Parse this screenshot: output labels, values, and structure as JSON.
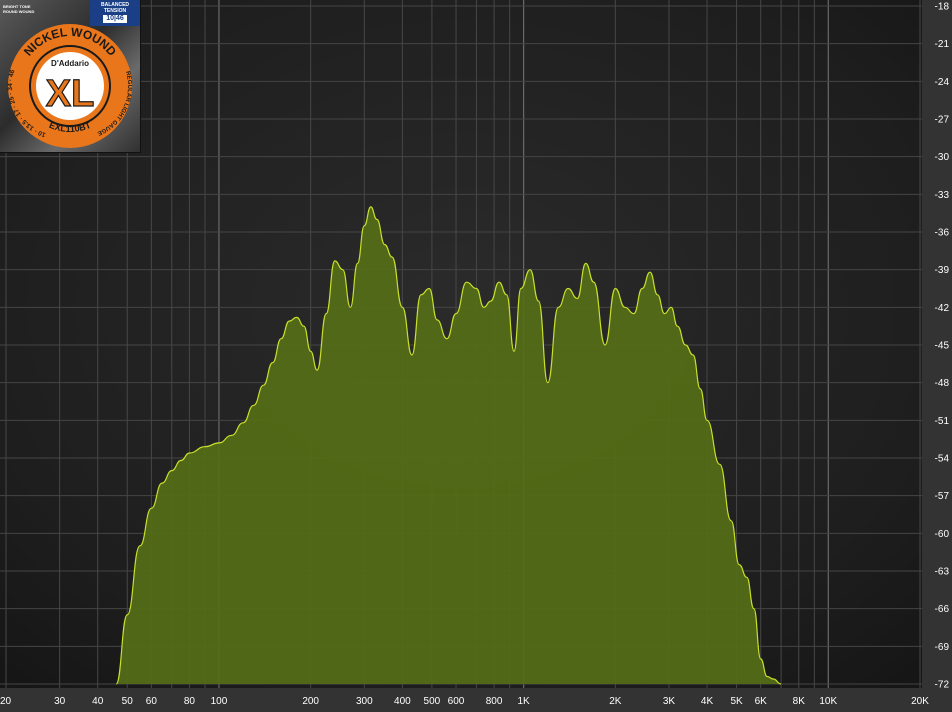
{
  "chart_data": {
    "type": "area",
    "title": "",
    "xlabel": "",
    "ylabel": "",
    "x_scale": "log",
    "xlim": [
      20,
      20000
    ],
    "ylim": [
      -72,
      -18
    ],
    "grid": true,
    "fill_color": "#546e16",
    "line_color": "#c8e02a",
    "background_color": "#1c1c1c",
    "x_tick_labels": [
      {
        "value": 20,
        "label": "20"
      },
      {
        "value": 30,
        "label": "30"
      },
      {
        "value": 40,
        "label": "40"
      },
      {
        "value": 50,
        "label": "50"
      },
      {
        "value": 60,
        "label": "60"
      },
      {
        "value": 80,
        "label": "80"
      },
      {
        "value": 100,
        "label": "100"
      },
      {
        "value": 200,
        "label": "200"
      },
      {
        "value": 300,
        "label": "300"
      },
      {
        "value": 400,
        "label": "400"
      },
      {
        "value": 500,
        "label": "500"
      },
      {
        "value": 600,
        "label": "600"
      },
      {
        "value": 800,
        "label": "800"
      },
      {
        "value": 1000,
        "label": "1K"
      },
      {
        "value": 2000,
        "label": "2K"
      },
      {
        "value": 3000,
        "label": "3K"
      },
      {
        "value": 4000,
        "label": "4K"
      },
      {
        "value": 5000,
        "label": "5K"
      },
      {
        "value": 6000,
        "label": "6K"
      },
      {
        "value": 8000,
        "label": "8K"
      },
      {
        "value": 10000,
        "label": "10K"
      },
      {
        "value": 20000,
        "label": "20K"
      }
    ],
    "y_tick_labels": [
      {
        "value": -18,
        "label": "-18"
      },
      {
        "value": -21,
        "label": "-21"
      },
      {
        "value": -24,
        "label": "-24"
      },
      {
        "value": -27,
        "label": "-27"
      },
      {
        "value": -30,
        "label": "-30"
      },
      {
        "value": -33,
        "label": "-33"
      },
      {
        "value": -36,
        "label": "-36"
      },
      {
        "value": -39,
        "label": "-39"
      },
      {
        "value": -42,
        "label": "-42"
      },
      {
        "value": -45,
        "label": "-45"
      },
      {
        "value": -48,
        "label": "-48"
      },
      {
        "value": -51,
        "label": "-51"
      },
      {
        "value": -54,
        "label": "-54"
      },
      {
        "value": -57,
        "label": "-57"
      },
      {
        "value": -60,
        "label": "-60"
      },
      {
        "value": -63,
        "label": "-63"
      },
      {
        "value": -66,
        "label": "-66"
      },
      {
        "value": -69,
        "label": "-69"
      },
      {
        "value": -72,
        "label": "-72"
      }
    ],
    "series": [
      {
        "x": [
          46,
          50,
          55,
          60,
          65,
          70,
          75,
          80,
          90,
          100,
          110,
          120,
          130,
          140,
          150,
          160,
          170,
          180,
          190,
          200,
          210,
          225,
          240,
          255,
          270,
          285,
          300,
          315,
          330,
          350,
          370,
          400,
          430,
          460,
          490,
          520,
          560,
          600,
          650,
          700,
          740,
          780,
          830,
          880,
          930,
          980,
          1050,
          1120,
          1200,
          1300,
          1400,
          1500,
          1600,
          1700,
          1850,
          2000,
          2150,
          2300,
          2450,
          2600,
          2750,
          2900,
          3050,
          3200,
          3400,
          3600,
          3800,
          4000,
          4400,
          4800,
          5100,
          5400,
          5700,
          6000,
          6300,
          6600,
          7000
        ],
        "y": [
          -72,
          -66.5,
          -61,
          -58,
          -56,
          -55,
          -54.2,
          -53.6,
          -53.1,
          -52.8,
          -52.2,
          -51.2,
          -49.8,
          -48.2,
          -46.4,
          -44.5,
          -43.1,
          -42.8,
          -43.5,
          -45.5,
          -47,
          -42.5,
          -38.3,
          -39,
          -42,
          -38.5,
          -35.5,
          -34,
          -35,
          -37,
          -38,
          -42,
          -45.8,
          -41,
          -40.5,
          -43,
          -44.5,
          -42.5,
          -40,
          -40.5,
          -42,
          -41.5,
          -40,
          -41,
          -45.5,
          -40.5,
          -39,
          -41.5,
          -48,
          -42,
          -40.5,
          -41.3,
          -38.5,
          -40,
          -45,
          -40.5,
          -42,
          -42.5,
          -40.5,
          -39.2,
          -41,
          -42.5,
          -42,
          -43.5,
          -45,
          -45.8,
          -48.5,
          -51,
          -54.5,
          -59,
          -62.5,
          -63.5,
          -66,
          -70,
          -71.4,
          -71.6,
          -72
        ]
      }
    ]
  },
  "badge": {
    "tag_left_line1": "BRIGHT TONE",
    "tag_left_line2": "ROUND WOUND",
    "tag_right_line1": "BALANCED",
    "tag_right_line2": "TENSION",
    "gauge": "10|46",
    "ring_top": "NICKEL WOUND",
    "brand": "D'Addario",
    "logo": "XL",
    "ring_left": "10 · 13.5 · 17 · 25 · 34 · 46",
    "ring_bottom": "EXL110BT",
    "ring_right": "REGULAR LIGHT GAUGE"
  }
}
